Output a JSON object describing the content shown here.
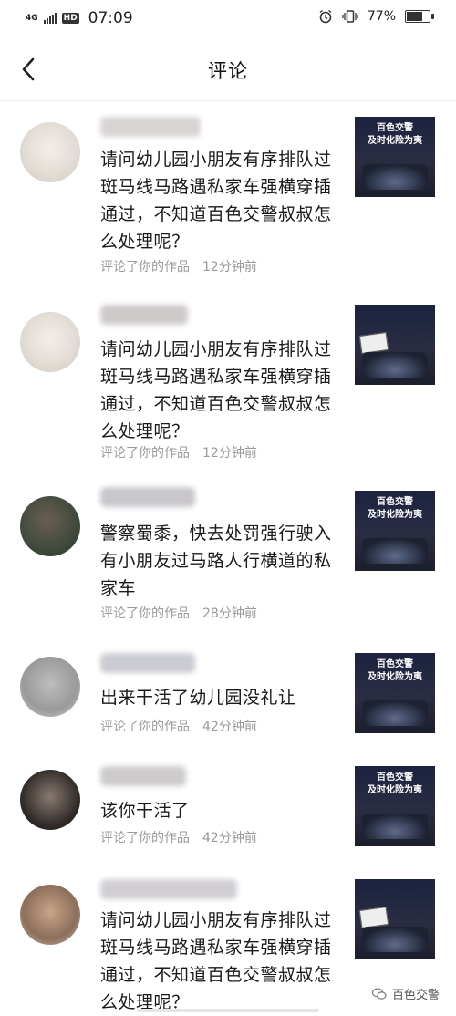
{
  "status": {
    "network": "4G",
    "hd": "HD",
    "time": "07:09",
    "battery": "77%",
    "battery_level": 0.77
  },
  "nav": {
    "title": "评论"
  },
  "comments": [
    {
      "text": "请问幼儿园小朋友有序排队过斑马线马路遇私家车强横穿插通过，不知道百色交警叔叔怎么处理呢？",
      "action": "评论了你的作品",
      "time": "12分钟前",
      "thumb_caption": "百色交警\n及时化险为夷"
    },
    {
      "text": "请问幼儿园小朋友有序排队过斑马线马路遇私家车强横穿插通过，不知道百色交警叔叔怎么处理呢？",
      "action": "评论了你的作品",
      "time": "12分钟前",
      "thumb_caption": ""
    },
    {
      "text": "警察蜀黍，快去处罚强行驶入有小朋友过马路人行横道的私家车",
      "action": "评论了你的作品",
      "time": "28分钟前",
      "thumb_caption": "百色交警\n及时化险为夷"
    },
    {
      "text": "出来干活了幼儿园没礼让",
      "action": "评论了你的作品",
      "time": "42分钟前",
      "thumb_caption": "百色交警\n及时化险为夷"
    },
    {
      "text": "该你干活了",
      "action": "评论了你的作品",
      "time": "42分钟前",
      "thumb_caption": "百色交警\n及时化险为夷"
    },
    {
      "text": "请问幼儿园小朋友有序排队过斑马线马路遇私家车强横穿插通过，不知道百色交警叔叔怎么处理呢？",
      "action": "",
      "time": "",
      "thumb_caption": ""
    }
  ],
  "watermark": "百色交警",
  "icons": {
    "back": "back-arrow-icon",
    "alarm": "alarm-icon",
    "vibrate": "vibrate-icon",
    "battery": "battery-icon",
    "wechat": "wechat-icon"
  }
}
